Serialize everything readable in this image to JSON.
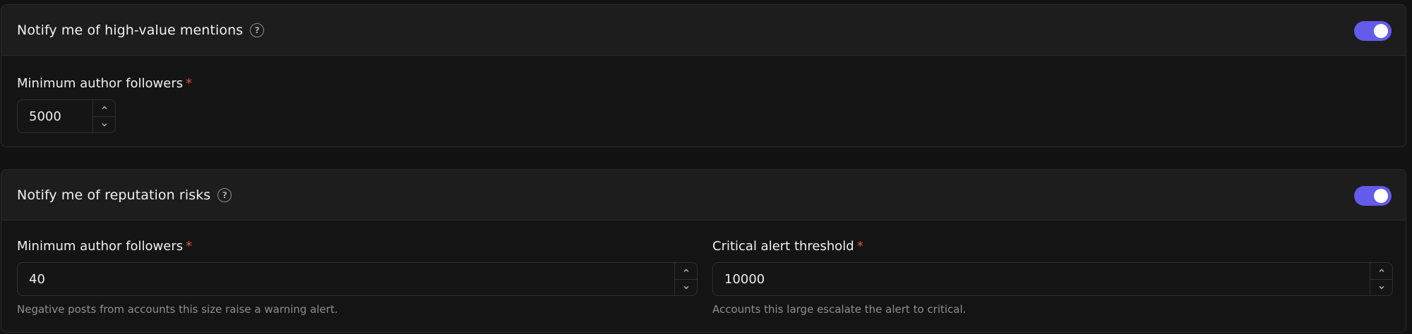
{
  "sections": [
    {
      "title": "Notify me of high-value mentions",
      "toggle_on": true,
      "fields": [
        {
          "label": "Minimum author followers",
          "required_mark": "*",
          "value": "5000",
          "help": ""
        }
      ]
    },
    {
      "title": "Notify me of reputation risks",
      "toggle_on": true,
      "fields": [
        {
          "label": "Minimum author followers",
          "required_mark": "*",
          "value": "40",
          "help": "Negative posts from accounts this size raise a warning alert."
        },
        {
          "label": "Critical alert threshold",
          "required_mark": "*",
          "value": "10000",
          "help": "Accounts this large escalate the alert to critical."
        }
      ]
    }
  ],
  "icons": {
    "help": "question-circle-icon",
    "increment": "chevron-up-icon",
    "decrement": "chevron-down-icon"
  },
  "colors": {
    "accent": "#635bea",
    "required": "#e2504f",
    "background": "#121212",
    "header": "#1d1d1d"
  }
}
